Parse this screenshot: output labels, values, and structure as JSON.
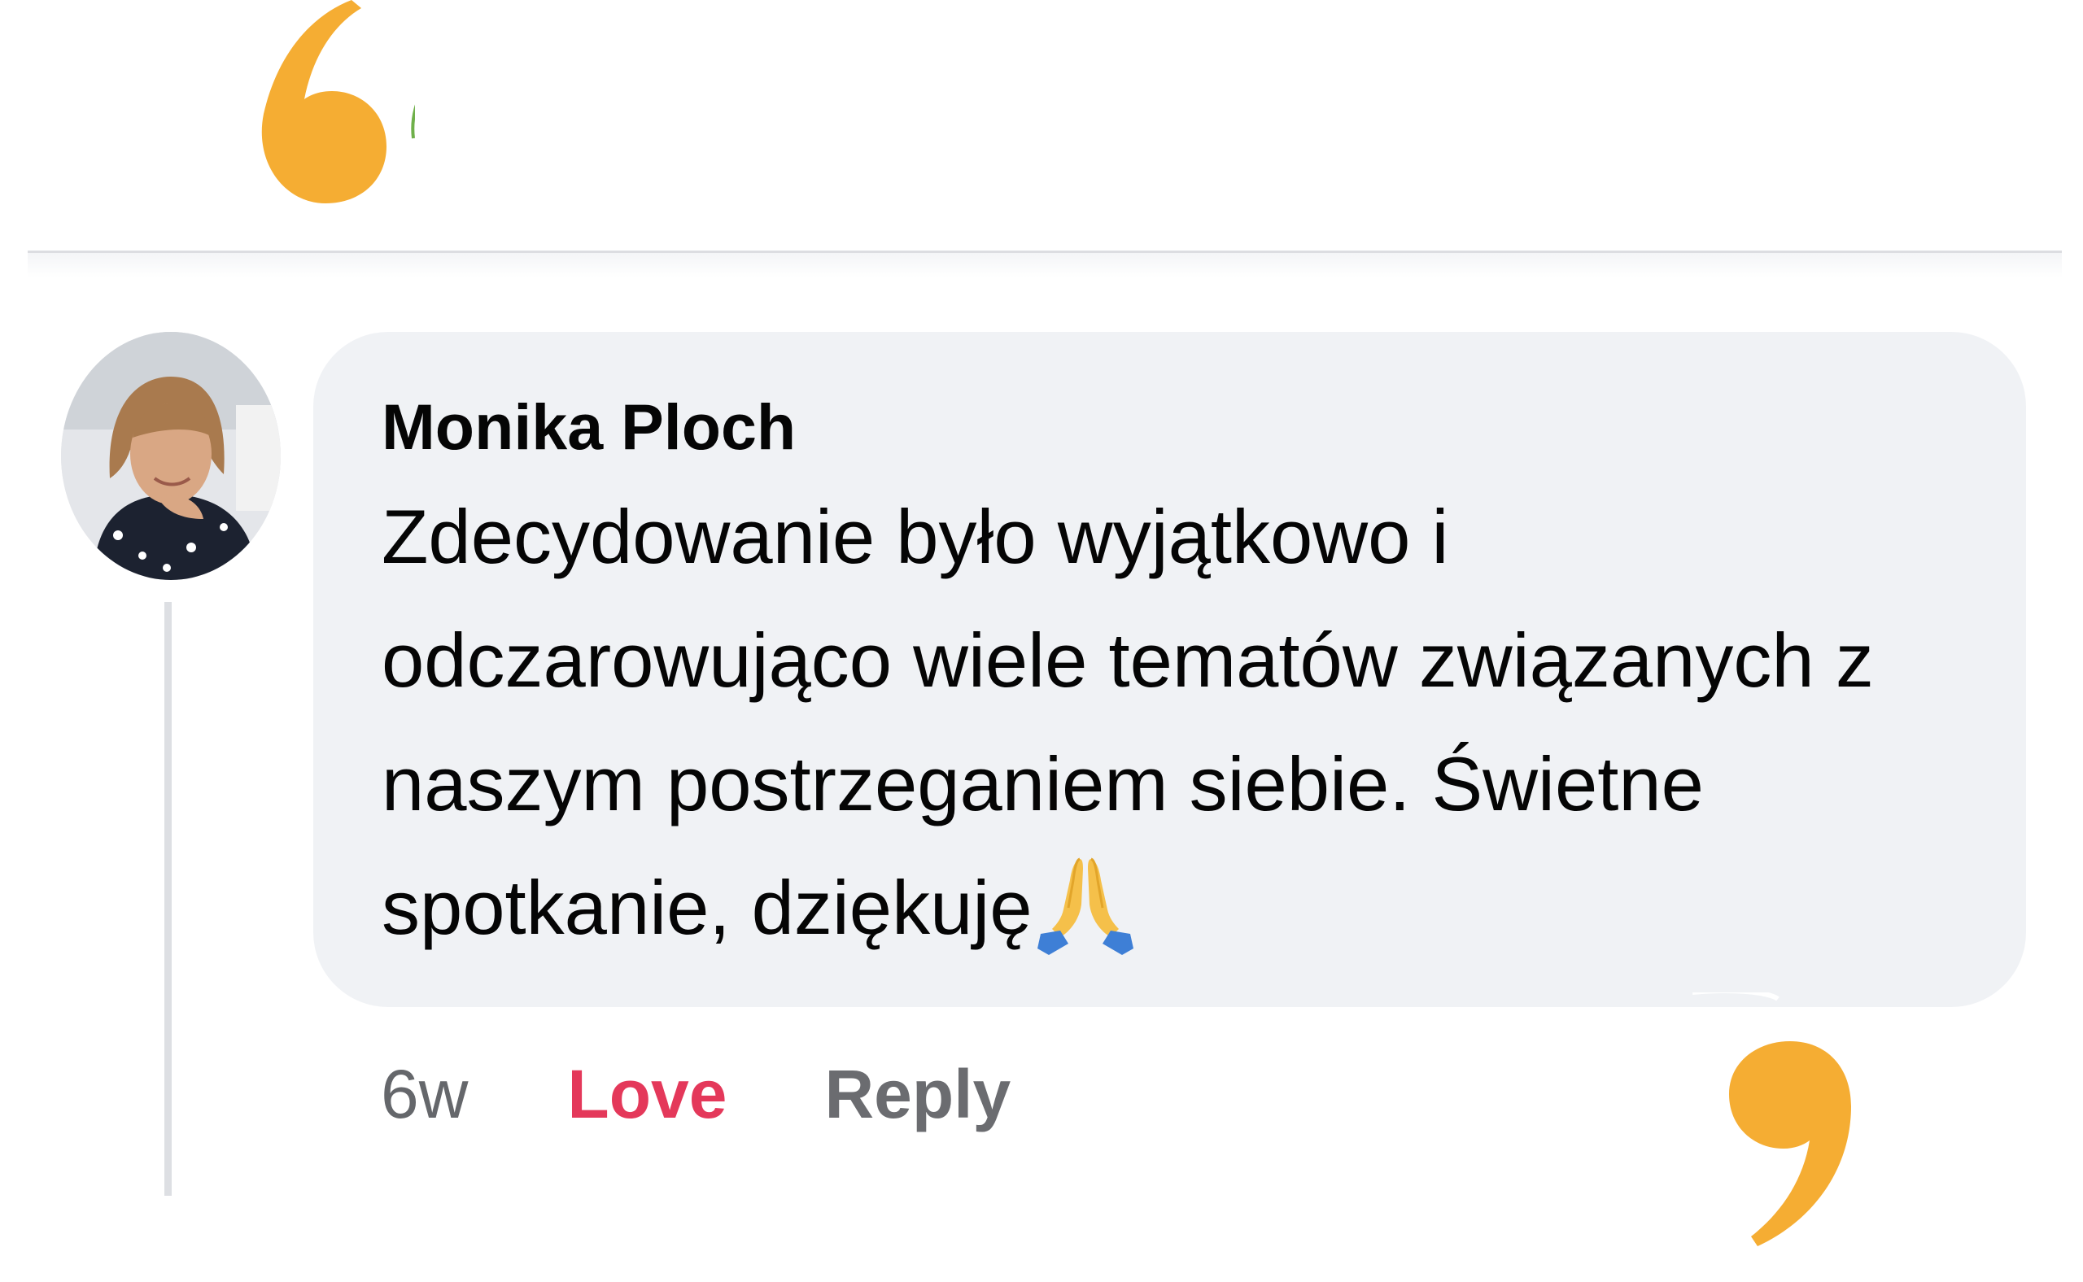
{
  "comment": {
    "author": "Monika Ploch",
    "text": "Zdecydowanie było wyjątkowo i odczarowująco wiele tematów związanych z naszym postrzeganiem siebie. Świetne spotkanie, dziękuję",
    "emoji": "folded-hands-icon",
    "age": "6w"
  },
  "actions": {
    "love_label": "Love",
    "reply_label": "Reply"
  },
  "colors": {
    "quote_accent": "#F5AD33",
    "love": "#E4385A",
    "bubble": "#F0F2F5"
  }
}
